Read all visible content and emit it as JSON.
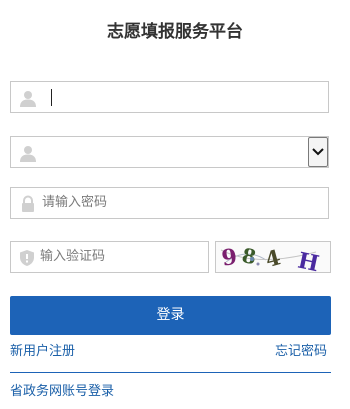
{
  "page": {
    "title": "志愿填报服务平台"
  },
  "form": {
    "username": {
      "value": "",
      "icon": "user-icon"
    },
    "account_type": {
      "value": "",
      "icon": "user-icon"
    },
    "password": {
      "placeholder": "请输入密码",
      "icon": "lock-icon"
    },
    "captcha": {
      "placeholder": "输入验证码",
      "icon": "shield-icon",
      "image_text": "984H"
    }
  },
  "actions": {
    "login_label": "登录",
    "register_label": "新用户注册",
    "forgot_label": "忘记密码",
    "gov_login_label": "省政务网账号登录"
  },
  "colors": {
    "primary": "#1d63b7",
    "link": "#1a5fa8",
    "border": "#c8c8c8"
  }
}
